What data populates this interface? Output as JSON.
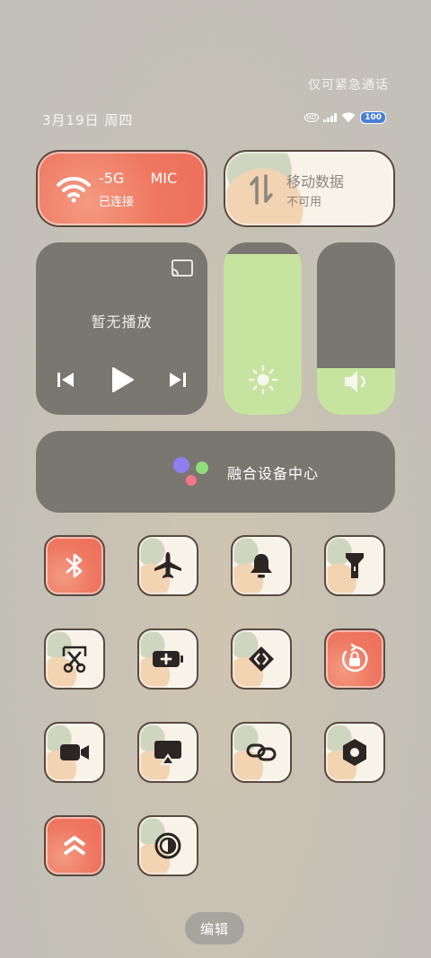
{
  "status": {
    "emergency_text": "仅可紧急通话",
    "date_text": "3月19日 周四",
    "battery_level": "100",
    "hd_label": "HD"
  },
  "wifi": {
    "title": "-5G",
    "title_suffix": "MIC",
    "subtitle": "已连接",
    "icon": "wifi-icon",
    "active": true
  },
  "mobile_data": {
    "title": "移动数据",
    "subtitle": "不可用",
    "icon": "mobile-data-icon",
    "active": false
  },
  "media": {
    "title": "暂无播放"
  },
  "brightness": {
    "level_percent": 93
  },
  "volume": {
    "level_percent": 27
  },
  "fusion": {
    "label": "融合设备中心"
  },
  "toggles": [
    {
      "name": "bluetooth-toggle",
      "icon": "bluetooth-icon",
      "active": true
    },
    {
      "name": "airplane-mode-toggle",
      "icon": "airplane-icon",
      "active": false
    },
    {
      "name": "ringer-toggle",
      "icon": "bell-icon",
      "active": false
    },
    {
      "name": "flashlight-toggle",
      "icon": "flashlight-icon",
      "active": false
    },
    {
      "name": "screenshot-toggle",
      "icon": "scissors-icon",
      "active": false
    },
    {
      "name": "battery-saver-toggle",
      "icon": "battery-plus-icon",
      "active": false
    },
    {
      "name": "code-scanner-toggle",
      "icon": "diamond-code-icon",
      "active": false
    },
    {
      "name": "rotation-lock-toggle",
      "icon": "rotation-lock-icon",
      "active": true
    },
    {
      "name": "screen-recorder-toggle",
      "icon": "video-camera-icon",
      "active": false
    },
    {
      "name": "screen-cast-toggle",
      "icon": "airplay-icon",
      "active": false
    },
    {
      "name": "link-toggle",
      "icon": "link-icon",
      "active": false
    },
    {
      "name": "settings-toggle",
      "icon": "hex-gear-icon",
      "active": false
    },
    {
      "name": "performance-toggle",
      "icon": "double-chevron-up-icon",
      "active": true
    },
    {
      "name": "dark-mode-toggle",
      "icon": "contrast-icon",
      "active": false
    }
  ],
  "edit_button": {
    "label": "编辑"
  },
  "colors": {
    "peach": "#ef7760",
    "cream": "#f8f3e8",
    "slider_fill": "#c7e3a0",
    "panel": "#7a7670"
  }
}
